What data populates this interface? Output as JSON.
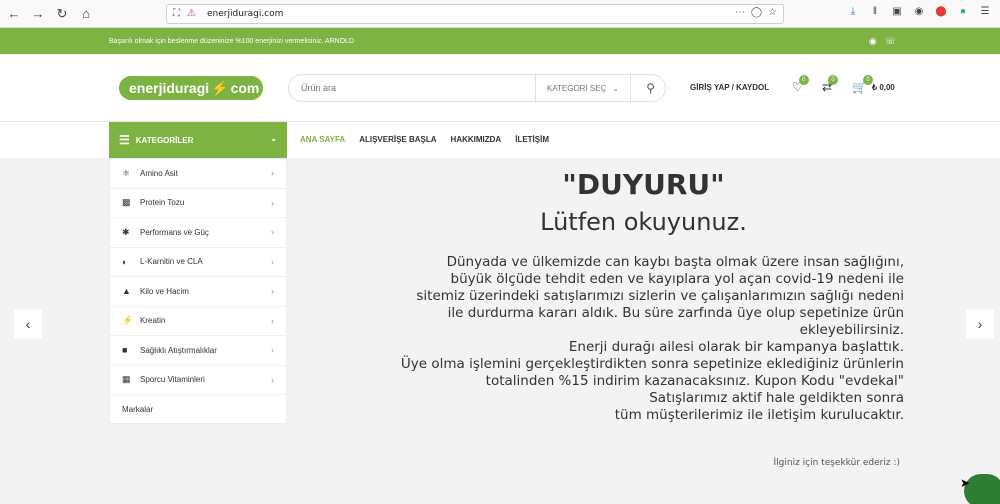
{
  "browser": {
    "url": "enerjiduragi.com",
    "icons": [
      "back-arrow",
      "forward-arrow",
      "reload",
      "home",
      "shield",
      "more",
      "pocket",
      "star",
      "download",
      "library",
      "sidebar",
      "account",
      "addon",
      "extension",
      "menu"
    ]
  },
  "promo": {
    "text": "Başarılı olmak için beslenme düzeninize %100 enerjinizi vermelisiniz. ARNOLD",
    "social": [
      "instagram-icon",
      "whatsapp-icon"
    ]
  },
  "header": {
    "logo_left": "enerjiduragi",
    "logo_right": "com",
    "search_placeholder": "Ürün ara",
    "category_select": "KATEGORİ SEÇ",
    "login": "GİRİŞ YAP / KAYDOL",
    "wishlist_count": "0",
    "compare_count": "0",
    "cart_count": "0",
    "cart_total": "₺ 0,00"
  },
  "nav": {
    "categories_label": "KATEGORİLER",
    "menu": [
      {
        "label": "ANA SAYFA",
        "active": true
      },
      {
        "label": "ALIŞVERİŞE BAŞLA",
        "active": false
      },
      {
        "label": "HAKKIMIZDA",
        "active": false
      },
      {
        "label": "İLETİŞİM",
        "active": false
      }
    ]
  },
  "sidebar": {
    "items": [
      {
        "label": "Amino Asit",
        "icon": "molecule-icon"
      },
      {
        "label": "Protein Tozu",
        "icon": "protein-jar-icon"
      },
      {
        "label": "Performans ve Güç",
        "icon": "muscle-icon"
      },
      {
        "label": "L-Karnitin ve CLA",
        "icon": "gauge-icon"
      },
      {
        "label": "Kilo ve Hacim",
        "icon": "weight-bag-icon"
      },
      {
        "label": "Kreatin",
        "icon": "lightning-icon"
      },
      {
        "label": "Sağlıklı Atıştırmalıklar",
        "icon": "snack-bar-icon"
      },
      {
        "label": "Sporcu Vitaminleri",
        "icon": "vitamin-icon"
      },
      {
        "label": "Markalar",
        "icon": ""
      }
    ]
  },
  "announcement": {
    "title": "\"DUYURU\"",
    "subtitle": "Lütfen okuyunuz.",
    "lines": [
      "Dünyada ve ülkemizde can kaybı başta olmak üzere insan sağlığını,",
      "büyük ölçüde tehdit eden ve kayıplara yol açan covid-19 nedeni ile",
      "sitemiz üzerindeki satışlarımızı sizlerin ve çalışanlarımızın sağlığı nedeni",
      "ile durdurma kararı aldık. Bu süre zarfında üye olup sepetinize ürün",
      "ekleyebilirsiniz.",
      "Enerji durağı ailesi olarak bir kampanya başlattık.",
      "Üye olma işlemini gerçekleştirdikten sonra sepetinize eklediğiniz ürünlerin",
      "totalinden %15 indirim kazanacaksınız. Kupon Kodu \"evdekal\"",
      "Satışlarımız aktif hale geldikten sonra",
      "tüm müşterilerimiz ile iletişim kurulucaktır."
    ],
    "thanks": "İlginiz için teşekkür ederiz :)"
  },
  "colors": {
    "brand_green": "#7cb342",
    "chat_green": "#2e7d32"
  }
}
